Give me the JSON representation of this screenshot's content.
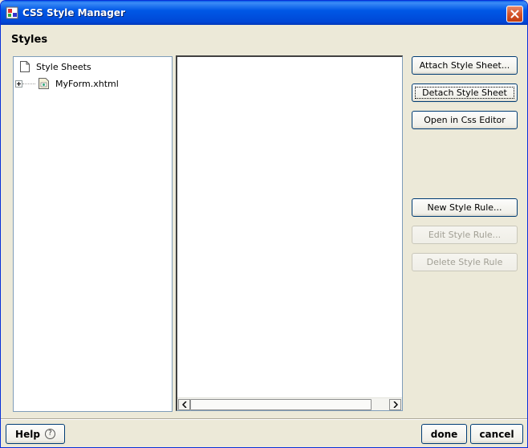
{
  "window": {
    "title": "CSS Style Manager"
  },
  "heading": "Styles",
  "tree": {
    "root_label": "Style Sheets",
    "children": [
      {
        "label": "MyForm.xhtml"
      }
    ]
  },
  "buttons": {
    "attach": "Attach Style Sheet...",
    "detach": "Detach Style Sheet",
    "open_editor": "Open in Css Editor",
    "new_rule": "New Style Rule...",
    "edit_rule": "Edit Style Rule...",
    "delete_rule": "Delete Style Rule"
  },
  "footer": {
    "help": "Help",
    "help_glyph": "?",
    "done": "done",
    "cancel": "cancel"
  },
  "icons": {
    "app": "css-manager-icon",
    "close": "close-icon",
    "folder": "document-icon",
    "file": "css-file-icon"
  }
}
